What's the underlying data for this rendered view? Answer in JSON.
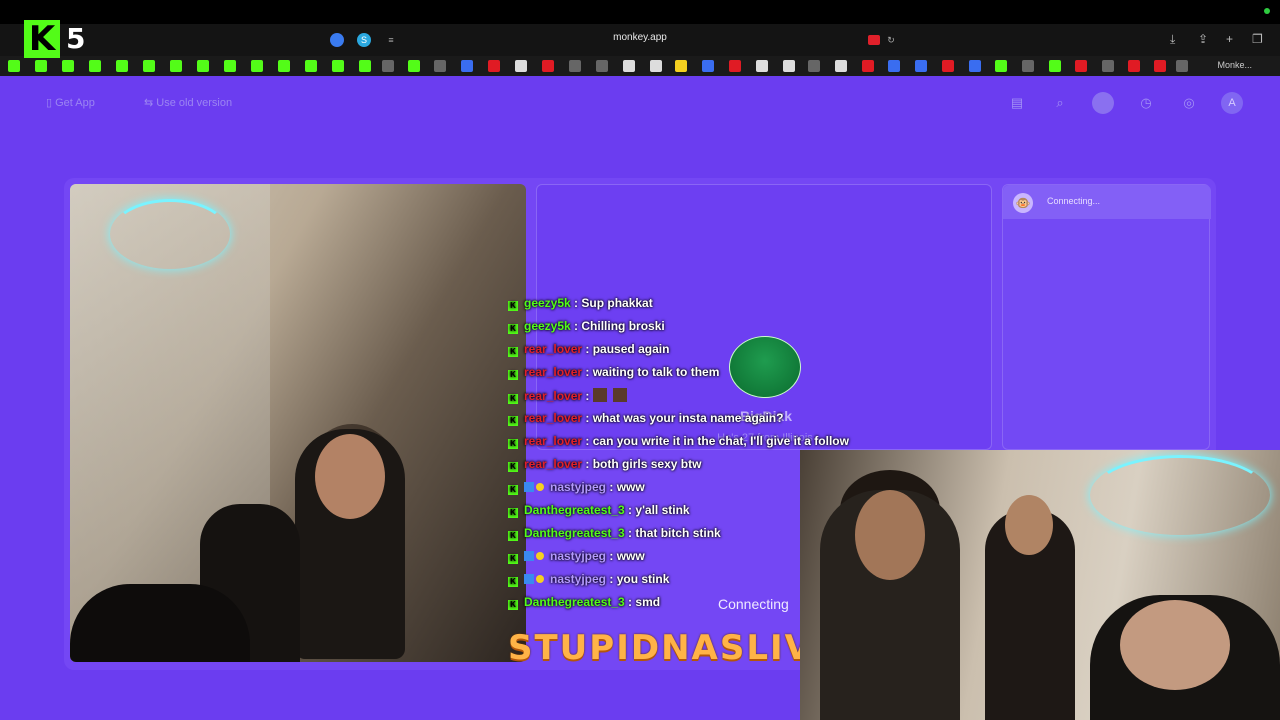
{
  "browser": {
    "url": "monkey.app",
    "last_bookmark": "Monke..."
  },
  "stream_overlay": {
    "logo_number": "5",
    "brand": "STUPIDNASLIVE"
  },
  "app_header": {
    "get_app_label": "Get App",
    "use_old_version_label": "Use old version",
    "profile_initial": "A"
  },
  "side_panel": {
    "connecting_label": "Connecting..."
  },
  "partner": {
    "name": "BigDixk",
    "subtitle": "He's 27 from Illinois",
    "status": "Connecting"
  },
  "chat": [
    {
      "user": "geezy5k",
      "text": "Sup phakkat",
      "color": "green",
      "badges": [
        "kick"
      ]
    },
    {
      "user": "geezy5k",
      "text": "Chilling broski",
      "color": "green",
      "badges": [
        "kick"
      ]
    },
    {
      "user": "rear_lover",
      "text": "paused again",
      "color": "red",
      "badges": [
        "kick"
      ]
    },
    {
      "user": "rear_lover",
      "text": "waiting to talk to them",
      "color": "red",
      "badges": [
        "kick"
      ]
    },
    {
      "user": "rear_lover",
      "text": "",
      "color": "red",
      "badges": [
        "kick"
      ]
    },
    {
      "user": "rear_lover",
      "text": "what was your insta name again?",
      "color": "red",
      "badges": [
        "kick"
      ]
    },
    {
      "user": "rear_lover",
      "text": "can you write it in the chat, I'll give it a follow",
      "color": "red",
      "badges": [
        "kick"
      ]
    },
    {
      "user": "rear_lover",
      "text": "both girls sexy btw",
      "color": "red",
      "badges": [
        "kick"
      ]
    },
    {
      "user": "nastyjpeg",
      "text": "www",
      "color": "purple",
      "badges": [
        "kick",
        "blue",
        "gold"
      ]
    },
    {
      "user": "Danthegreatest_3",
      "text": "y'all stink",
      "color": "green",
      "badges": [
        "kick"
      ]
    },
    {
      "user": "Danthegreatest_3",
      "text": "that bitch stink",
      "color": "green",
      "badges": [
        "kick"
      ]
    },
    {
      "user": "nastyjpeg",
      "text": "www",
      "color": "purple",
      "badges": [
        "kick",
        "blue",
        "gold"
      ]
    },
    {
      "user": "nastyjpeg",
      "text": "you stink",
      "color": "purple",
      "badges": [
        "kick",
        "blue",
        "gold"
      ]
    },
    {
      "user": "Danthegreatest_3",
      "text": "smd",
      "color": "green",
      "badges": [
        "kick"
      ]
    }
  ],
  "colors": {
    "app_bg": "#6b3df0",
    "kick_green": "#53fc18",
    "brand_orange": "#ffb347"
  }
}
